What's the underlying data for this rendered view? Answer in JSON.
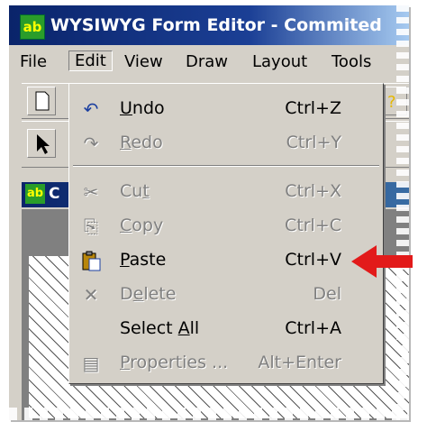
{
  "window": {
    "title": "WYSIWYG Form Editor - Commited",
    "icon_name": "form-editor-icon",
    "icon_text": "ab"
  },
  "menubar": {
    "items": [
      {
        "label": "File"
      },
      {
        "label": "Edit",
        "active": true
      },
      {
        "label": "View"
      },
      {
        "label": "Draw"
      },
      {
        "label": "Layout"
      },
      {
        "label": "Tools"
      }
    ]
  },
  "child_window": {
    "title": "C",
    "icon_text": "ab"
  },
  "edit_menu": {
    "items": [
      {
        "icon": "undo-icon",
        "label": "Undo",
        "mnemonic": "U",
        "shortcut": "Ctrl+Z",
        "enabled": true
      },
      {
        "icon": "redo-icon",
        "label": "Redo",
        "mnemonic": "R",
        "shortcut": "Ctrl+Y",
        "enabled": false
      },
      {
        "icon": "cut-icon",
        "label": "Cut",
        "mnemonic": "t",
        "shortcut": "Ctrl+X",
        "enabled": false
      },
      {
        "icon": "copy-icon",
        "label": "Copy",
        "mnemonic": "C",
        "shortcut": "Ctrl+C",
        "enabled": false
      },
      {
        "icon": "paste-icon",
        "label": "Paste",
        "mnemonic": "P",
        "shortcut": "Ctrl+V",
        "enabled": true
      },
      {
        "icon": "delete-icon",
        "label": "Delete",
        "mnemonic": "e",
        "shortcut": "Del",
        "enabled": false
      },
      {
        "icon": "",
        "label": "Select All",
        "mnemonic": "A",
        "shortcut": "Ctrl+A",
        "enabled": true
      },
      {
        "icon": "properties-icon",
        "label": "Properties ...",
        "mnemonic": "P",
        "shortcut": "Alt+Enter",
        "enabled": false
      }
    ]
  },
  "annotation": {
    "arrow_color": "#e21a1a",
    "points_to": "Paste"
  },
  "colors": {
    "titlebar": "#0a246a",
    "face": "#d4d0c8",
    "disabled_text": "#808080"
  }
}
